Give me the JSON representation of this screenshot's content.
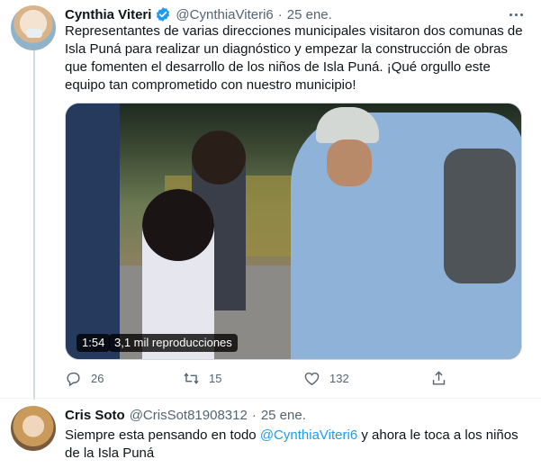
{
  "tweets": [
    {
      "author_name": "Cynthia Viteri",
      "verified": true,
      "handle": "@CynthiaViteri6",
      "separator": "·",
      "date": "25 ene.",
      "text": "Representantes de varias direcciones municipales visitaron dos comunas de Isla Puná para realizar un diagnóstico y empezar la construcción de obras que fomenten el desarrollo de los niños de Isla Puná. ¡Qué orgullo este equipo tan comprometido con nuestro municipio!",
      "video": {
        "duration": "1:54",
        "views": "3,1 mil reproducciones"
      },
      "actions": {
        "replies": "26",
        "retweets": "15",
        "likes": "132"
      }
    },
    {
      "author_name": "Cris Soto",
      "handle": "@CrisSot81908312",
      "separator": "·",
      "date": "25 ene.",
      "text_before": "Siempre esta pensando en todo ",
      "mention": "@CynthiaViteri6",
      "text_after": " y ahora le toca a los niños de la Isla Puná"
    }
  ],
  "icons": {
    "verified": "verified-badge-icon",
    "more": "more-horizontal-icon",
    "reply": "reply-icon",
    "retweet": "retweet-icon",
    "like": "heart-icon",
    "share": "share-icon"
  },
  "colors": {
    "accent": "#1d9bf0",
    "text": "#0f1419",
    "muted": "#536471",
    "thread_line": "#cfd9de"
  }
}
